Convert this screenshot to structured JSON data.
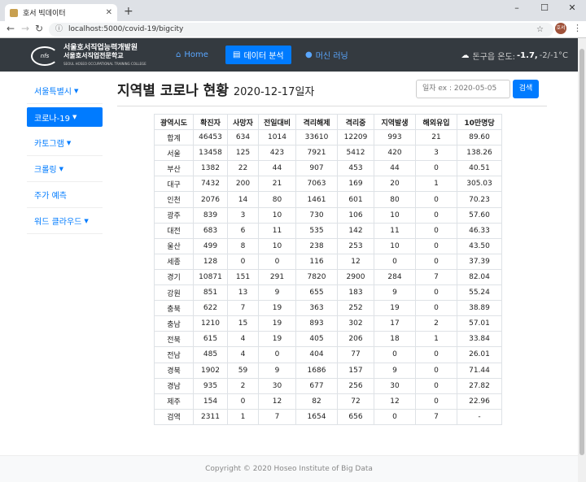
{
  "browser": {
    "tab_title": "호서 빅데이터",
    "new_tab": "+",
    "window_controls": [
      "–",
      "☐",
      "✕"
    ],
    "url": "localhost:5000/covid-19/bigcity",
    "profile": "호서"
  },
  "navbar": {
    "logo_line1": "서울호서직업능력개발원",
    "logo_line2": "서울호서직업전문학교",
    "logo_line3": "SEOUL HOSEO OCCUPATIONAL TRAINING COLLEGE",
    "items": [
      {
        "label": "Home",
        "icon": "home-icon"
      },
      {
        "label": "데이터 분석",
        "icon": "chart-icon"
      },
      {
        "label": "머신 러닝",
        "icon": "globe-icon"
      }
    ],
    "weather_label": "돈구읍 온도:",
    "weather_temp": "-1.7,",
    "weather_range": "-2/-1°C"
  },
  "sidebar": {
    "items": [
      {
        "label": "서울특별시"
      },
      {
        "label": "코로나-19"
      },
      {
        "label": "카토그램"
      },
      {
        "label": "크롤링"
      },
      {
        "label": "주가 예측"
      },
      {
        "label": "워드 클라우드"
      }
    ]
  },
  "main": {
    "title": "지역별 코로나 현황",
    "date": "2020-12-17일자",
    "date_placeholder": "일자 ex : 2020-05-05",
    "search_label": "검색"
  },
  "table": {
    "headers": [
      "광역시도",
      "확진자",
      "사망자",
      "전일대비",
      "격리해제",
      "격리중",
      "지역발생",
      "해외유입",
      "10만명당"
    ],
    "rows": [
      [
        "합계",
        "46453",
        "634",
        "1014",
        "33610",
        "12209",
        "993",
        "21",
        "89.60"
      ],
      [
        "서울",
        "13458",
        "125",
        "423",
        "7921",
        "5412",
        "420",
        "3",
        "138.26"
      ],
      [
        "부산",
        "1382",
        "22",
        "44",
        "907",
        "453",
        "44",
        "0",
        "40.51"
      ],
      [
        "대구",
        "7432",
        "200",
        "21",
        "7063",
        "169",
        "20",
        "1",
        "305.03"
      ],
      [
        "인천",
        "2076",
        "14",
        "80",
        "1461",
        "601",
        "80",
        "0",
        "70.23"
      ],
      [
        "광주",
        "839",
        "3",
        "10",
        "730",
        "106",
        "10",
        "0",
        "57.60"
      ],
      [
        "대전",
        "683",
        "6",
        "11",
        "535",
        "142",
        "11",
        "0",
        "46.33"
      ],
      [
        "울산",
        "499",
        "8",
        "10",
        "238",
        "253",
        "10",
        "0",
        "43.50"
      ],
      [
        "세종",
        "128",
        "0",
        "0",
        "116",
        "12",
        "0",
        "0",
        "37.39"
      ],
      [
        "경기",
        "10871",
        "151",
        "291",
        "7820",
        "2900",
        "284",
        "7",
        "82.04"
      ],
      [
        "강원",
        "851",
        "13",
        "9",
        "655",
        "183",
        "9",
        "0",
        "55.24"
      ],
      [
        "충북",
        "622",
        "7",
        "19",
        "363",
        "252",
        "19",
        "0",
        "38.89"
      ],
      [
        "충남",
        "1210",
        "15",
        "19",
        "893",
        "302",
        "17",
        "2",
        "57.01"
      ],
      [
        "전북",
        "615",
        "4",
        "19",
        "405",
        "206",
        "18",
        "1",
        "33.84"
      ],
      [
        "전남",
        "485",
        "4",
        "0",
        "404",
        "77",
        "0",
        "0",
        "26.01"
      ],
      [
        "경북",
        "1902",
        "59",
        "9",
        "1686",
        "157",
        "9",
        "0",
        "71.44"
      ],
      [
        "경남",
        "935",
        "2",
        "30",
        "677",
        "256",
        "30",
        "0",
        "27.82"
      ],
      [
        "제주",
        "154",
        "0",
        "12",
        "82",
        "72",
        "12",
        "0",
        "22.96"
      ],
      [
        "검역",
        "2311",
        "1",
        "7",
        "1654",
        "656",
        "0",
        "7",
        "-"
      ]
    ]
  },
  "footer": {
    "copyright": "Copyright © 2020 Hoseo Institute of Big Data"
  }
}
